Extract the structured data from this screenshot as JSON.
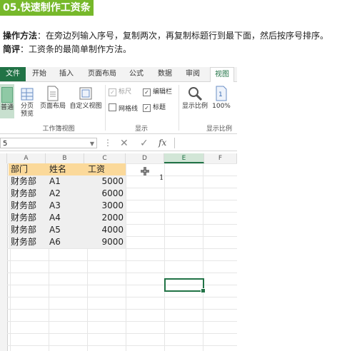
{
  "article": {
    "title": "05.快速制作工资条",
    "op_label": "操作方法",
    "op_text": "：在旁边列输入序号，复制两次，再复制标题行到最下面，然后按序号排序。",
    "brief_label": "简评",
    "brief_text": "：工资条的最简单制作方法。"
  },
  "excel": {
    "tabs": [
      "文件",
      "开始",
      "插入",
      "页面布局",
      "公式",
      "数据",
      "审阅",
      "视图"
    ],
    "ribbon": {
      "normal": "普通",
      "page_break": "分页\n预览",
      "page_layout": "页面布局",
      "custom_view": "自定义视图",
      "workbook_views_group": "工作簿视图",
      "ruler": "标尺",
      "formula_bar": "编辑栏",
      "gridlines": "网格线",
      "headings": "标题",
      "show_group": "显示",
      "zoom": "显示比例",
      "zoom100": "100%",
      "zoom_group": "显示比例",
      "ruler_checked": true,
      "formula_bar_checked": true,
      "gridlines_checked": false,
      "headings_checked": true
    },
    "name_box": "5",
    "fx": "fx",
    "columns": [
      "A",
      "B",
      "C",
      "D",
      "E",
      "F"
    ],
    "selected_column": "E",
    "header_row": [
      "部门",
      "姓名",
      "工资"
    ],
    "rows": [
      [
        "财务部",
        "A1",
        "5000"
      ],
      [
        "财务部",
        "A2",
        "6000"
      ],
      [
        "财务部",
        "A3",
        "3000"
      ],
      [
        "财务部",
        "A4",
        "2000"
      ],
      [
        "财务部",
        "A5",
        "4000"
      ],
      [
        "财务部",
        "A6",
        "9000"
      ]
    ],
    "e_value": "1",
    "accent": "#217346",
    "header_fill": "#fbd99a"
  }
}
